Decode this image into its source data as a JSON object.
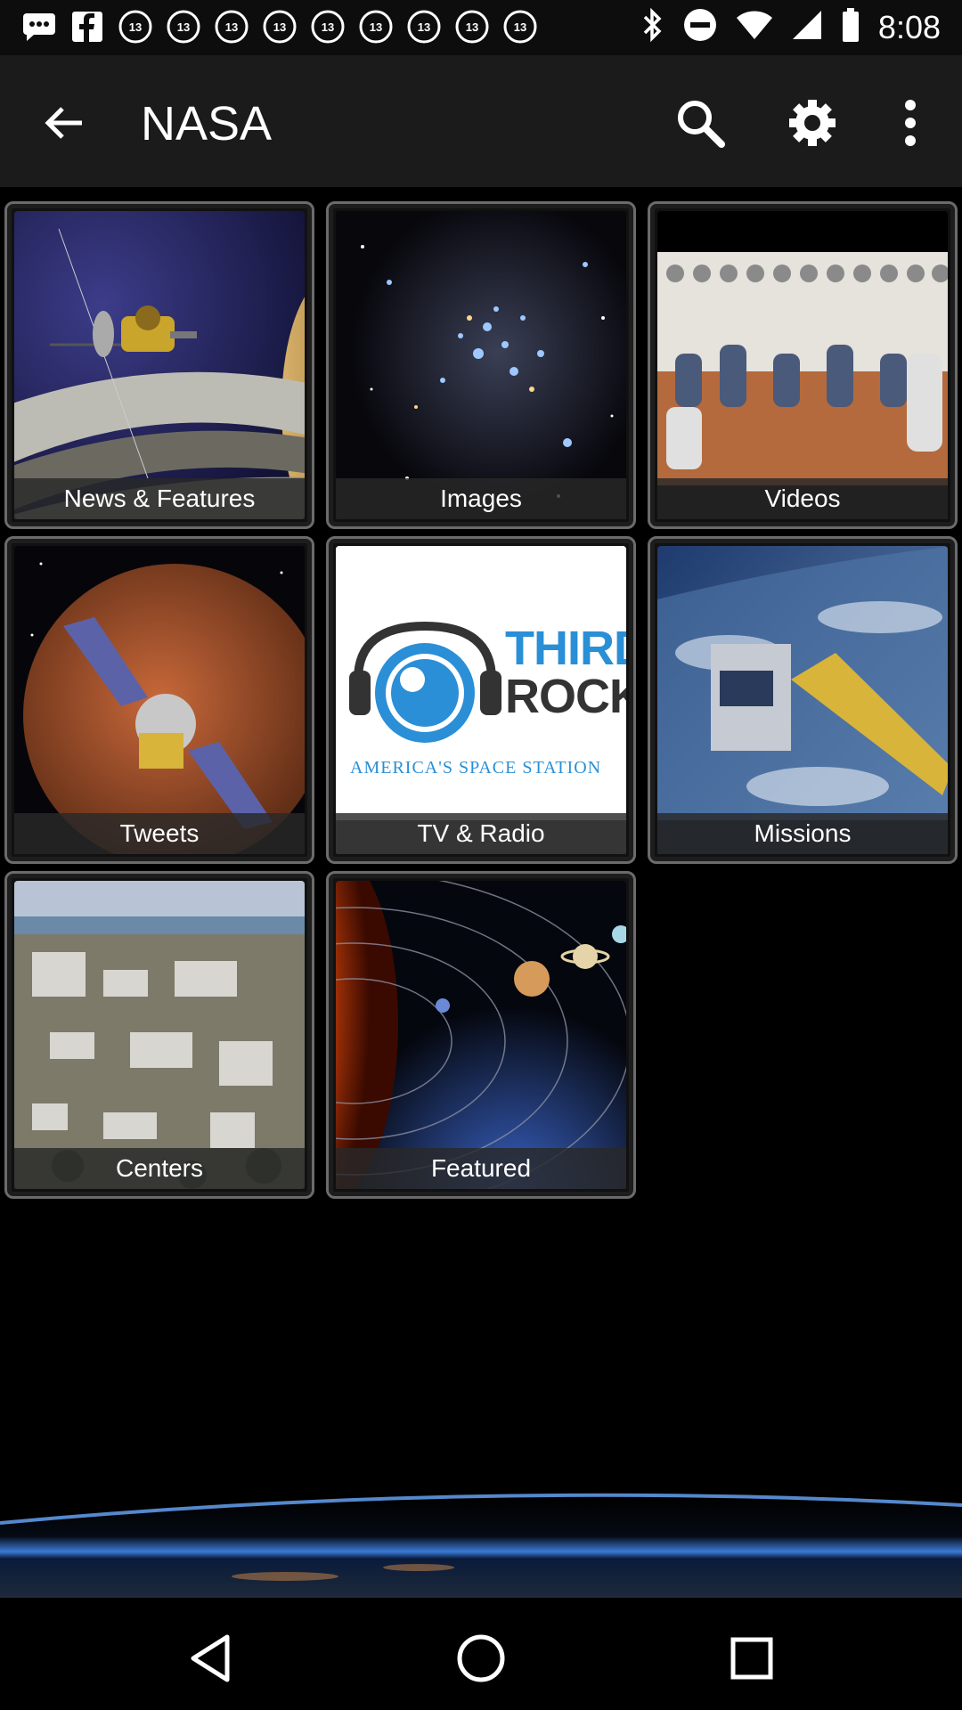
{
  "status_bar": {
    "time": "8:08",
    "notification_icons": [
      "sms-icon",
      "facebook-icon",
      "abc13-icon",
      "abc13-icon",
      "abc13-icon",
      "abc13-icon",
      "abc13-icon",
      "abc13-icon",
      "abc13-icon",
      "abc13-icon",
      "abc13-icon"
    ],
    "abc_text": "abc13"
  },
  "appbar": {
    "title": "NASA"
  },
  "tiles": [
    {
      "label": "News & Features"
    },
    {
      "label": "Images"
    },
    {
      "label": "Videos"
    },
    {
      "label": "Tweets"
    },
    {
      "label": "TV & Radio"
    },
    {
      "label": "Missions"
    },
    {
      "label": "Centers"
    },
    {
      "label": "Featured"
    }
  ],
  "tv_radio_art": {
    "line1": "THIRD",
    "line2": "ROCK",
    "tagline": "AMERICA'S SPACE STATION"
  },
  "colors": {
    "appbar": "#1b1b1b",
    "background": "#000000",
    "tile_border": "#6b6b6b"
  }
}
